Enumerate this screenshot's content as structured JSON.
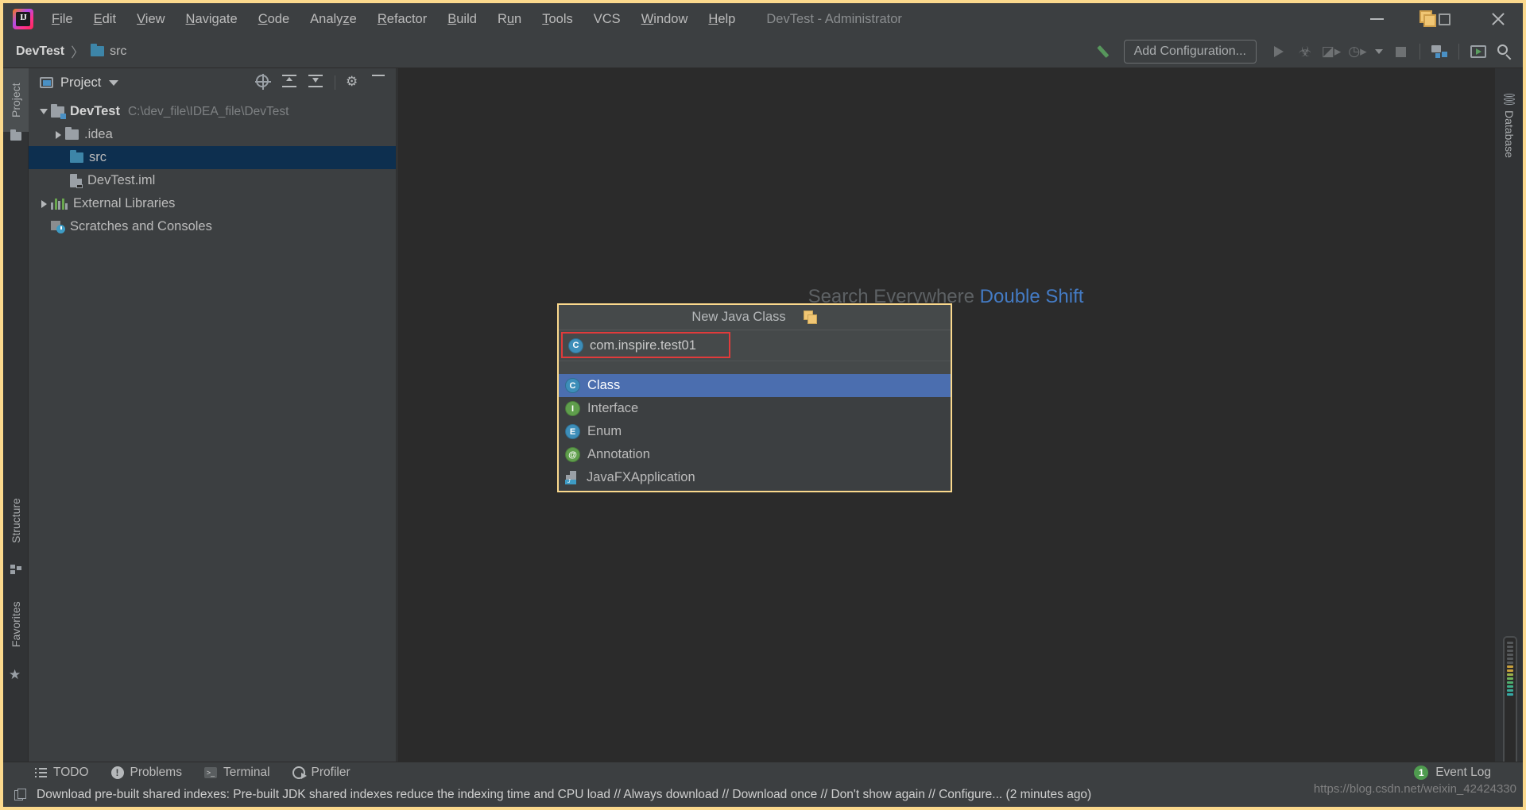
{
  "window": {
    "title": "DevTest - Administrator",
    "controls": {
      "minimize": "minimize-icon",
      "restore": "restore-icon",
      "close": "close-icon"
    }
  },
  "menubar": {
    "logo": "intellij-idea-logo",
    "items": [
      {
        "label": "File",
        "mnemonic": "F"
      },
      {
        "label": "Edit",
        "mnemonic": "E"
      },
      {
        "label": "View",
        "mnemonic": "V"
      },
      {
        "label": "Navigate",
        "mnemonic": "N"
      },
      {
        "label": "Code",
        "mnemonic": "C"
      },
      {
        "label": "Analyze",
        "mnemonic": "z"
      },
      {
        "label": "Refactor",
        "mnemonic": "R"
      },
      {
        "label": "Build",
        "mnemonic": "B"
      },
      {
        "label": "Run",
        "mnemonic": "u"
      },
      {
        "label": "Tools",
        "mnemonic": "T"
      },
      {
        "label": "VCS",
        "mnemonic": ""
      },
      {
        "label": "Window",
        "mnemonic": "W"
      },
      {
        "label": "Help",
        "mnemonic": "H"
      }
    ]
  },
  "toolbar": {
    "breadcrumb": {
      "project": "DevTest",
      "separator": "〉",
      "current": "src"
    },
    "build_icon": "hammer-icon",
    "add_configuration": "Add Configuration...",
    "run_icon": "run-icon",
    "debug_icon": "debug-icon",
    "run_with_coverage_icon": "run-with-coverage-icon",
    "profile_icon": "profile-icon",
    "dropdown_icon": "chevron-down-icon",
    "stop_icon": "stop-icon",
    "project_structure_icon": "project-structure-icon",
    "updates_icon": "updates-icon",
    "search_icon": "search-icon"
  },
  "left_stripe": {
    "items": [
      {
        "label": "Project",
        "icon": "project-icon",
        "active": true
      },
      {
        "label": "Structure",
        "icon": "structure-icon",
        "active": false
      },
      {
        "label": "Favorites",
        "icon": "star-icon",
        "active": false
      }
    ]
  },
  "right_stripe": {
    "items": [
      {
        "label": "Database",
        "icon": "database-icon"
      }
    ]
  },
  "project_panel": {
    "title": "Project",
    "title_icon": "project-window-icon",
    "actions": [
      {
        "name": "select-opened-file",
        "icon": "target-icon"
      },
      {
        "name": "expand-all",
        "icon": "expand-all-icon"
      },
      {
        "name": "collapse-all",
        "icon": "collapse-all-icon"
      },
      {
        "name": "settings",
        "icon": "gear-icon"
      },
      {
        "name": "hide",
        "icon": "minus-icon"
      }
    ],
    "tree": [
      {
        "label": "DevTest",
        "path": "C:\\dev_file\\IDEA_file\\DevTest",
        "icon": "module-icon",
        "expanded": true,
        "indent": 0,
        "selected": false,
        "bold": true
      },
      {
        "label": ".idea",
        "path": "",
        "icon": "folder-icon-grey",
        "expanded": false,
        "indent": 1,
        "selected": false,
        "bold": false
      },
      {
        "label": "src",
        "path": "",
        "icon": "folder-icon-blue",
        "expanded": null,
        "indent": 1,
        "selected": true,
        "bold": false
      },
      {
        "label": "DevTest.iml",
        "path": "",
        "icon": "iml-file-icon",
        "expanded": null,
        "indent": 1,
        "selected": false,
        "bold": false
      },
      {
        "label": "External Libraries",
        "path": "",
        "icon": "library-icon",
        "expanded": false,
        "indent": 0,
        "selected": false,
        "bold": false
      },
      {
        "label": "Scratches and Consoles",
        "path": "",
        "icon": "scratches-icon",
        "expanded": null,
        "indent": 0,
        "selected": false,
        "bold": false
      }
    ]
  },
  "editor": {
    "watermark_text": "Search Everywhere",
    "watermark_shortcut": "Double Shift"
  },
  "dialog": {
    "title": "New Java Class",
    "title_icon": "copy-icon",
    "input_value": "com.inspire.test01",
    "input_icon": "class-icon",
    "highlight_color": "#e03b3b",
    "border_color": "#fbd98d",
    "items": [
      {
        "label": "Class",
        "icon": "class-icon",
        "glyph": "C",
        "selected": true
      },
      {
        "label": "Interface",
        "icon": "interface-icon",
        "glyph": "I",
        "selected": false
      },
      {
        "label": "Enum",
        "icon": "enum-icon",
        "glyph": "E",
        "selected": false
      },
      {
        "label": "Annotation",
        "icon": "annotation-icon",
        "glyph": "@",
        "selected": false
      },
      {
        "label": "JavaFXApplication",
        "icon": "javafx-icon",
        "glyph": "J",
        "selected": false
      }
    ]
  },
  "bottom_bar": {
    "items": [
      {
        "label": "TODO",
        "icon": "todo-icon"
      },
      {
        "label": "Problems",
        "icon": "problems-icon"
      },
      {
        "label": "Terminal",
        "icon": "terminal-icon"
      },
      {
        "label": "Profiler",
        "icon": "profiler-icon"
      }
    ],
    "event_log": {
      "label": "Event Log",
      "count": "1",
      "badge_color": "#4f9c4f"
    }
  },
  "status_bar": {
    "icon": "notification-icon",
    "message": "Download pre-built shared indexes: Pre-built JDK shared indexes reduce the indexing time and CPU load // Always download // Download once // Don't show again // Configure... (2 minutes ago)"
  },
  "watermark_url": "https://blog.csdn.net/weixin_42424330"
}
